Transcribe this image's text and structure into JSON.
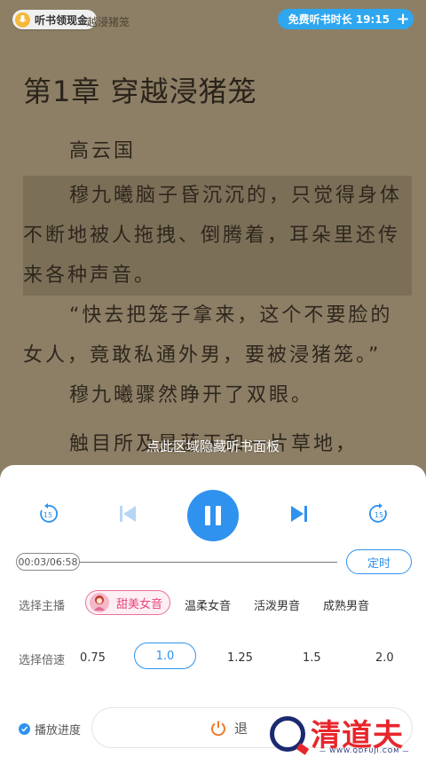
{
  "header": {
    "listen_earn_label": "听书领现金",
    "chapter_hint": "越浸猪笼",
    "free_listen_label": "免费听书时长 19:15",
    "plus_symbol": "+"
  },
  "content": {
    "chapter_title": "第1章  穿越浸猪笼",
    "paragraphs": [
      "高云国",
      "穆九曦脑子昏沉沉的，只觉得身体不断地被人拖拽、倒腾着，耳朵里还传来各种声音。",
      "“快去把笼子拿来，这个不要脸的女人，竟敢私通外男，要被浸猪笼。”",
      "穆九曦骤然睁开了双眼。",
      "触目所及是蓝天和一片草地，"
    ],
    "hide_panel_hint": "点此区域隐藏听书面板"
  },
  "player": {
    "rewind_label": "15",
    "forward_label": "15",
    "time_display": "00:03/06:58",
    "timer_label": "定时",
    "progress": 0.007,
    "voice_label": "选择主播",
    "voices": [
      "甜美女音",
      "温柔女音",
      "活泼男音",
      "成熟男音"
    ],
    "selected_voice": "甜美女音",
    "speed_label": "选择倍速",
    "speeds": [
      "0.75",
      "1.0",
      "1.25",
      "1.5",
      "2.0"
    ],
    "selected_speed": "1.0",
    "sync_progress_label": "播放进度",
    "exit_label": "退"
  },
  "watermark": {
    "brand": "清道夫",
    "url": "— WWW.QDFUJI.COM —"
  },
  "colors": {
    "accent": "#2f92ee",
    "page_bg": "#8d7f66",
    "voice_accent": "#e8447c",
    "badge_yellow": "#f4b93c"
  }
}
